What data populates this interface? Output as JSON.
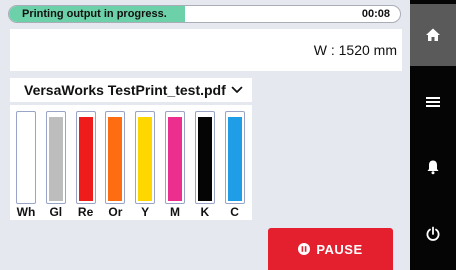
{
  "status": {
    "message": "Printing output in progress.",
    "time": "00:08",
    "progress_percent": 45,
    "progress_color": "#6cd1a8"
  },
  "media": {
    "width_text": "W : 1520 mm"
  },
  "job": {
    "file_name": "VersaWorks TestPrint_test.pdf",
    "dropdown_icon": "chevron-down-icon"
  },
  "inks": [
    {
      "label": "Wh",
      "color": "#ffffff",
      "level": 0.96
    },
    {
      "label": "Gl",
      "color": "#bdbdbd",
      "level": 0.96
    },
    {
      "label": "Re",
      "color": "#ef1c1c",
      "level": 0.96
    },
    {
      "label": "Or",
      "color": "#ff6d12",
      "level": 0.96
    },
    {
      "label": "Y",
      "color": "#ffd700",
      "level": 0.96
    },
    {
      "label": "M",
      "color": "#ec2e8f",
      "level": 0.96
    },
    {
      "label": "K",
      "color": "#050505",
      "level": 0.96
    },
    {
      "label": "C",
      "color": "#1f9de6",
      "level": 0.96
    }
  ],
  "actions": {
    "pause_label": "PAUSE",
    "pause_icon": "pause-circle-icon",
    "pause_color": "#e4202e"
  },
  "sidebar": {
    "items": [
      {
        "icon": "home-icon",
        "active": true
      },
      {
        "icon": "menu-icon",
        "active": false
      },
      {
        "icon": "bell-icon",
        "active": false
      },
      {
        "icon": "power-icon",
        "active": false
      }
    ]
  }
}
